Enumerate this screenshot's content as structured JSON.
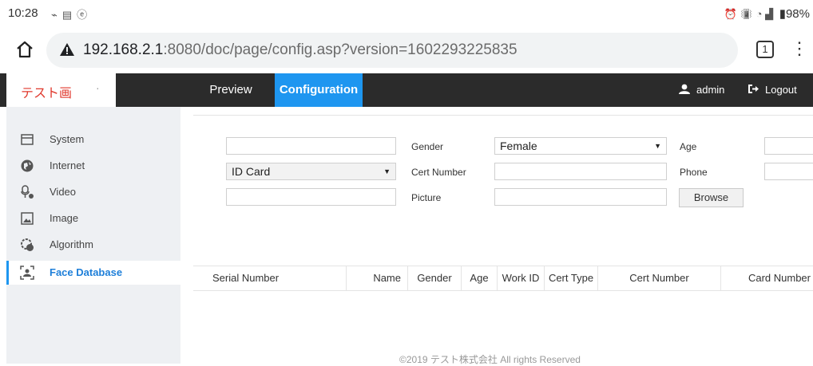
{
  "status_bar": {
    "time": "10:28",
    "left_icons": [
      "wifi-call-icon",
      "keyboard-icon",
      "e-icon"
    ],
    "right_icons": [
      "alarm-icon",
      "vibrate-icon",
      "wifi-icon",
      "signal-icon"
    ],
    "battery": "98%"
  },
  "browser": {
    "url_host": "192.168.2.1",
    "url_path": ":8080/doc/page/config.asp?version=1602293225835",
    "tabs_count": "1"
  },
  "header": {
    "brand": "テスト画",
    "brand_suffix": "·",
    "nav": [
      "Preview",
      "Configuration"
    ],
    "active_nav": "Configuration",
    "user": "admin",
    "logout": "Logout",
    "accent_color": "#1e96f0"
  },
  "sidebar": {
    "items": [
      {
        "label": "System",
        "icon": "system-icon"
      },
      {
        "label": "Internet",
        "icon": "internet-icon"
      },
      {
        "label": "Video",
        "icon": "video-icon"
      },
      {
        "label": "Image",
        "icon": "image-icon"
      },
      {
        "label": "Algorithm",
        "icon": "algorithm-icon"
      },
      {
        "label": "Face Database",
        "icon": "face-database-icon"
      }
    ],
    "active": "Face Database"
  },
  "form": {
    "name_value": "",
    "gender_label": "Gender",
    "gender_value": "Female",
    "age_label": "Age",
    "age_value": "",
    "cert_type_value": "ID Card",
    "cert_number_label": "Cert Number",
    "cert_number_value": "",
    "phone_label": "Phone",
    "phone_value": "",
    "extra_value": "",
    "picture_label": "Picture",
    "picture_value": "",
    "browse_label": "Browse"
  },
  "table": {
    "columns": [
      "Serial Number",
      "Name",
      "Gender",
      "Age",
      "Work ID",
      "Cert Type",
      "Cert Number",
      "Card Number"
    ],
    "rows": []
  },
  "footer": "©2019 テスト株式会社 All rights Reserved"
}
